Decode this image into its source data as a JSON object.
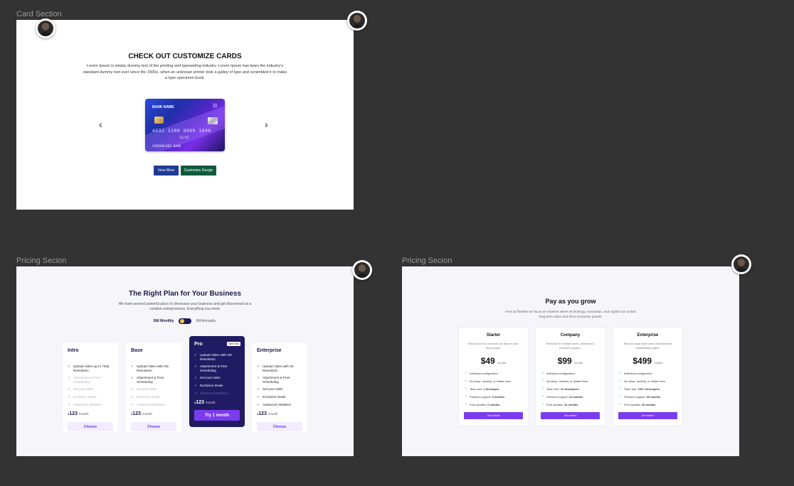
{
  "labels": {
    "card_section": "Card Section",
    "pricing_1": "Pricing Secion",
    "pricing_2": "Pricing Secion"
  },
  "card_section": {
    "title": "CHECK OUT CUSTOMIZE CARDS",
    "description": "Lorem Ipsum is simply dummy text of the printing and typesetting industry. Lorem Ipsum has been the industry's standard dummy text ever since the 1500s, when an unknown printer took a galley of type and scrambled it to make a type specimen book.",
    "prev_icon": "chevron-left-icon",
    "next_icon": "chevron-right-icon",
    "card": {
      "bank_name": "BANK NAME",
      "number": "4532 3100 9999 1040",
      "expiry": "12/25",
      "holder": "CARDHOLDER NAME"
    },
    "view_more": "View More",
    "customize": "Customize Design",
    "colors": {
      "view_more": "#1f3a93",
      "customize": "#0f5a3b"
    }
  },
  "pricing1": {
    "title": "The Right Plan for Your Business",
    "subtitle": "We have several powerful plans to showcase your business and get discovered as a creative entrepreneurs. Everything you need.",
    "bill_monthly": "Bill Monthly",
    "bill_annually": "Bill Annually",
    "plans": [
      {
        "name": "Intro",
        "badge": "",
        "features": [
          {
            "text": "Upload Video up to 720p Resolution",
            "on": true
          },
          {
            "text": "Attachment & Post Scheduling",
            "on": false
          },
          {
            "text": "Set your rates",
            "on": false
          },
          {
            "text": "Exclusive Deals",
            "on": false
          },
          {
            "text": "Advanced Statistics",
            "on": false
          }
        ],
        "currency": "$",
        "price": "123",
        "per": "/month",
        "button": "Choose"
      },
      {
        "name": "Base",
        "badge": "",
        "features": [
          {
            "text": "Upload Video with HD Resolution",
            "on": true
          },
          {
            "text": "Attachment & Post Scheduling",
            "on": true
          },
          {
            "text": "Set your rates",
            "on": false
          },
          {
            "text": "Exclusive Deals",
            "on": false
          },
          {
            "text": "Advanced Statistics",
            "on": false
          }
        ],
        "currency": "$",
        "price": "123",
        "per": "/month",
        "button": "Choose"
      },
      {
        "name": "Pro",
        "badge": "Save $40",
        "features": [
          {
            "text": "Upload Video with HD Resolution",
            "on": true
          },
          {
            "text": "Attachment & Post Scheduling",
            "on": true
          },
          {
            "text": "Set your rates",
            "on": true
          },
          {
            "text": "Exclusive Deals",
            "on": true
          },
          {
            "text": "Advanced Statistics",
            "on": false
          }
        ],
        "currency": "$",
        "price": "123",
        "per": "/month",
        "button": "Try 1 month"
      },
      {
        "name": "Enterprise",
        "badge": "",
        "features": [
          {
            "text": "Upload Video with 4K Resolution",
            "on": true
          },
          {
            "text": "Attachment & Post Scheduling",
            "on": true
          },
          {
            "text": "Set your rates",
            "on": true
          },
          {
            "text": "Exclusive Deals",
            "on": true
          },
          {
            "text": "Advanced Statistics",
            "on": true
          }
        ],
        "currency": "$",
        "price": "123",
        "per": "/month",
        "button": "Choose"
      }
    ]
  },
  "pricing2": {
    "title": "Pay as you grow",
    "subtitle": "Here at flowbite we focus on markets where technology, innovation, and capital can unlock long-term value and drive economic growth.",
    "tiers": [
      {
        "name": "Starter",
        "desc": "Best option for personal use and for your next project.",
        "price": "$49",
        "per": "/month",
        "features": [
          {
            "pre": "Individual configuration",
            "bold": ""
          },
          {
            "pre": "No setup, monthly, or hidden fees",
            "bold": ""
          },
          {
            "pre": "Team size: ",
            "bold": "1 developer"
          },
          {
            "pre": "Premium support: ",
            "bold": "6 months"
          },
          {
            "pre": "Free updates: ",
            "bold": "6 months"
          }
        ],
        "button": "Get started"
      },
      {
        "name": "Company",
        "desc": "Relevant for multiple users, extended & premium support.",
        "price": "$99",
        "per": "/month",
        "features": [
          {
            "pre": "Individual configuration",
            "bold": ""
          },
          {
            "pre": "No setup, monthly, or hidden fees",
            "bold": ""
          },
          {
            "pre": "Team size: ",
            "bold": "10 developers"
          },
          {
            "pre": "Premium support: ",
            "bold": "24 months"
          },
          {
            "pre": "Free updates: ",
            "bold": "24 months"
          }
        ],
        "button": "Get started"
      },
      {
        "name": "Enterprise",
        "desc": "Best for large scale uses and extended redistribution rights.",
        "price": "$499",
        "per": "/month",
        "features": [
          {
            "pre": "Individual configuration",
            "bold": ""
          },
          {
            "pre": "No setup, monthly, or hidden fees",
            "bold": ""
          },
          {
            "pre": "Team size: ",
            "bold": "100+ developers"
          },
          {
            "pre": "Premium support: ",
            "bold": "36 months"
          },
          {
            "pre": "Free updates: ",
            "bold": "36 months"
          }
        ],
        "button": "Get started"
      }
    ],
    "accent": "#7b3cf0"
  }
}
